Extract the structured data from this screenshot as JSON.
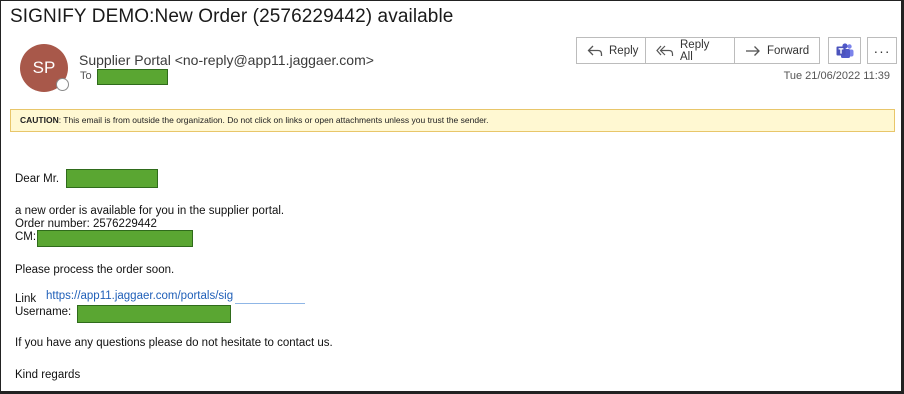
{
  "email": {
    "subject": "SIGNIFY DEMO:New Order (2576229442) available",
    "sender": "Supplier Portal <no-reply@app11.jaggaer.com>",
    "avatar_initials": "SP",
    "avatar_color": "#a8584a",
    "to_label": "To",
    "date": "Tue 21/06/2022 11:39"
  },
  "actions": {
    "reply": "Reply",
    "reply_all": "Reply All",
    "forward": "Forward",
    "teams_icon": "teams-icon",
    "more": "···"
  },
  "caution": {
    "label": "CAUTION",
    "text": ": This email is from outside the organization. Do not click on links or open attachments unless you trust the sender."
  },
  "body": {
    "greeting": "Dear Mr.",
    "line1": "a new order is available for you in the supplier portal.",
    "order_number": "Order number: 2576229442",
    "cm_label": "CM:",
    "process": "Please process the order soon.",
    "link_label": "Link",
    "link_url": "https://app11.jaggaer.com/portals/sig",
    "username_label": "Username:",
    "questions": "If you have any questions please do not hesitate to contact us.",
    "closing": "Kind regards"
  },
  "colors": {
    "redaction": "#5aa632",
    "caution_bg": "#fff8d2",
    "link": "#1f5fb8"
  }
}
